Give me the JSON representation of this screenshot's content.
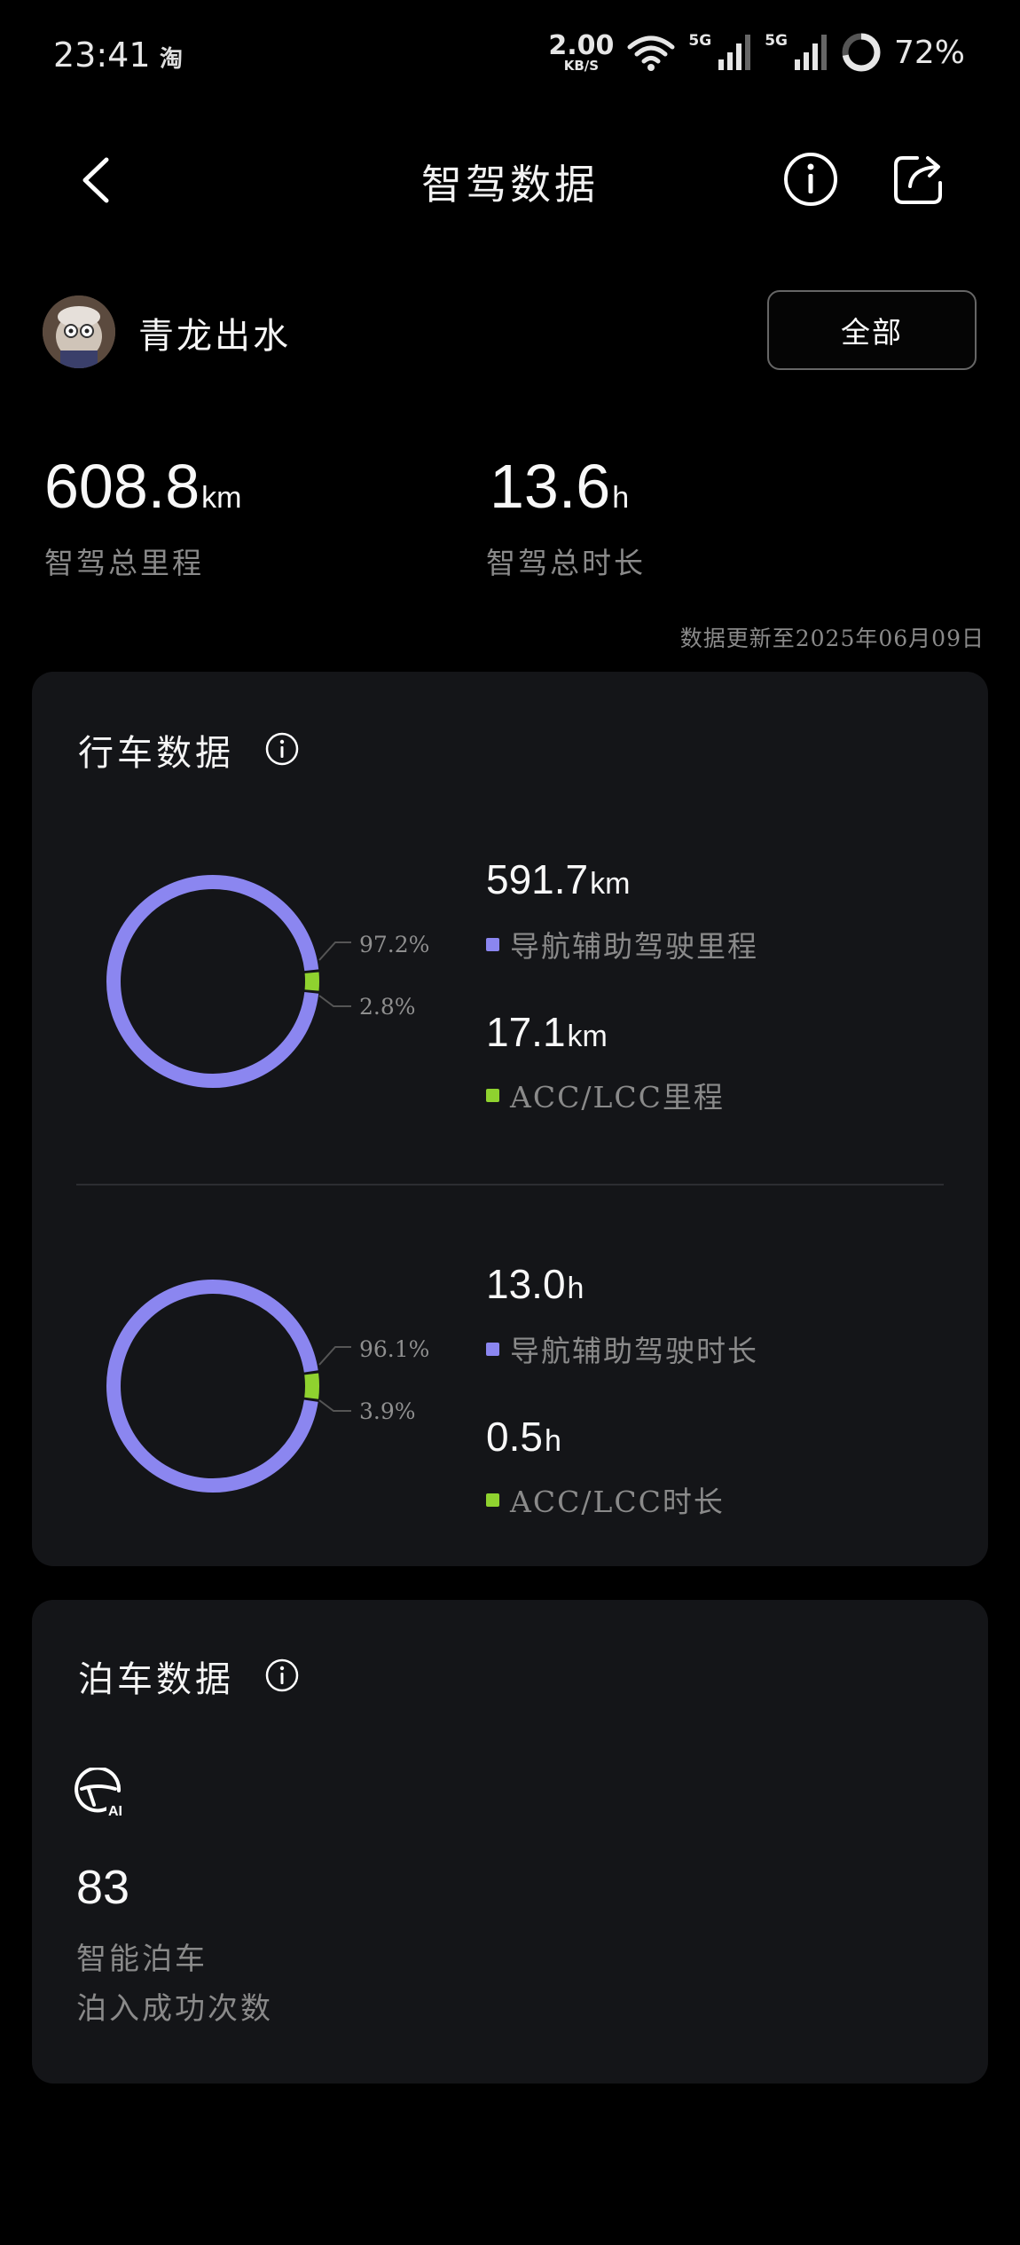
{
  "status_bar": {
    "time": "23:41",
    "app_badge": "淘",
    "net_speed_value": "2.00",
    "net_speed_unit": "KB/S",
    "signal1_label": "5G",
    "signal2_label": "5G",
    "battery": "72%",
    "battery_level": 0.72
  },
  "nav": {
    "title": "智驾数据",
    "back_icon": "chevron-left-icon",
    "info_icon": "info-icon",
    "share_icon": "share-icon"
  },
  "user": {
    "name": "青龙出水",
    "filter_label": "全部"
  },
  "totals": {
    "mileage_value": "608.8",
    "mileage_unit": "km",
    "mileage_label": "智驾总里程",
    "duration_value": "13.6",
    "duration_unit": "h",
    "duration_label": "智驾总时长",
    "updated_text": "数据更新至2025年06月09日"
  },
  "colors": {
    "nav_assist": "#8b86f0",
    "acc_lcc": "#8fd22f",
    "card_bg": "#141518",
    "muted_text": "#8a8a8a"
  },
  "driving_card": {
    "title": "行车数据",
    "distance": {
      "nav_value": "591.7",
      "nav_unit": "km",
      "nav_label": "导航辅助驾驶里程",
      "nav_pct": "97.2%",
      "nav_fraction": 0.972,
      "acc_value": "17.1",
      "acc_unit": "km",
      "acc_label": "ACC/LCC里程",
      "acc_pct": "2.8%",
      "acc_fraction": 0.028
    },
    "time": {
      "nav_value": "13.0",
      "nav_unit": "h",
      "nav_label": "导航辅助驾驶时长",
      "nav_pct": "96.1%",
      "nav_fraction": 0.961,
      "acc_value": "0.5",
      "acc_unit": "h",
      "acc_label": "ACC/LCC时长",
      "acc_pct": "3.9%",
      "acc_fraction": 0.039
    }
  },
  "parking_card": {
    "title": "泊车数据",
    "icon": "steering-wheel-ai-icon",
    "count": "83",
    "label_line1": "智能泊车",
    "label_line2": "泊入成功次数"
  }
}
